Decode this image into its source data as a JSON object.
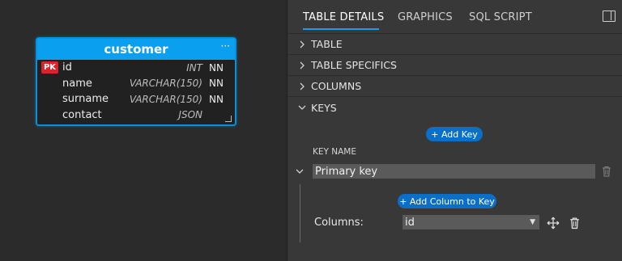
{
  "entity": {
    "name": "customer",
    "menu_icon": "ellipsis-icon",
    "columns": [
      {
        "badge": "PK",
        "name": "id",
        "type": "INT",
        "nn": "NN"
      },
      {
        "badge": "",
        "name": "name",
        "type": "VARCHAR(150)",
        "nn": "NN"
      },
      {
        "badge": "",
        "name": "surname",
        "type": "VARCHAR(150)",
        "nn": "NN"
      },
      {
        "badge": "",
        "name": "contact",
        "type": "JSON",
        "nn": ""
      }
    ]
  },
  "panel": {
    "tabs": [
      "TABLE DETAILS",
      "GRAPHICS",
      "SQL SCRIPT"
    ],
    "active_tab": "TABLE DETAILS",
    "sections": [
      "TABLE",
      "TABLE SPECIFICS",
      "COLUMNS",
      "KEYS"
    ],
    "keys": {
      "add_key_label": "+ Add Key",
      "key_name_header": "KEY NAME",
      "key_name_value": "Primary key",
      "add_column_label": "+ Add Column to Key",
      "columns_label": "Columns:",
      "selected_column": "id"
    }
  },
  "colors": {
    "accent": "#0aa0ef",
    "button": "#0c6fc7",
    "pk_badge": "#d9232d",
    "panel_bg": "#383838",
    "canvas_bg": "#2b2b2b"
  }
}
